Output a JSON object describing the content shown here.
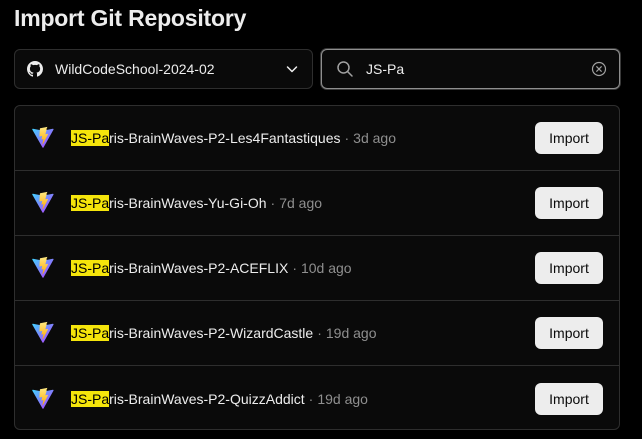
{
  "title": "Import Git Repository",
  "scope": {
    "icon": "github-icon",
    "value": "WildCodeSchool-2024-02",
    "chevron_icon": "chevron-down-icon"
  },
  "search": {
    "icon": "search-icon",
    "value": "JS-Pa",
    "clear_icon": "clear-circle-icon"
  },
  "repos": [
    {
      "match": "JS-Pa",
      "rest": "ris-BrainWaves-P2-Les4Fantastiques",
      "sep": "·",
      "age": "3d ago",
      "import_label": "Import",
      "icon": "vite-icon"
    },
    {
      "match": "JS-Pa",
      "rest": "ris-BrainWaves-Yu-Gi-Oh",
      "sep": "·",
      "age": "7d ago",
      "import_label": "Import",
      "icon": "vite-icon"
    },
    {
      "match": "JS-Pa",
      "rest": "ris-BrainWaves-P2-ACEFLIX",
      "sep": "·",
      "age": "10d ago",
      "import_label": "Import",
      "icon": "vite-icon"
    },
    {
      "match": "JS-Pa",
      "rest": "ris-BrainWaves-P2-WizardCastle",
      "sep": "·",
      "age": "19d ago",
      "import_label": "Import",
      "icon": "vite-icon"
    },
    {
      "match": "JS-Pa",
      "rest": "ris-BrainWaves-P2-QuizzAddict",
      "sep": "·",
      "age": "19d ago",
      "import_label": "Import",
      "icon": "vite-icon"
    }
  ],
  "colors": {
    "background": "#000000",
    "panel": "#0a0a0a",
    "border": "#2e2e2e",
    "highlight": "#f5e50b",
    "muted_text": "#8f8f8f",
    "button_bg": "#ededed"
  }
}
